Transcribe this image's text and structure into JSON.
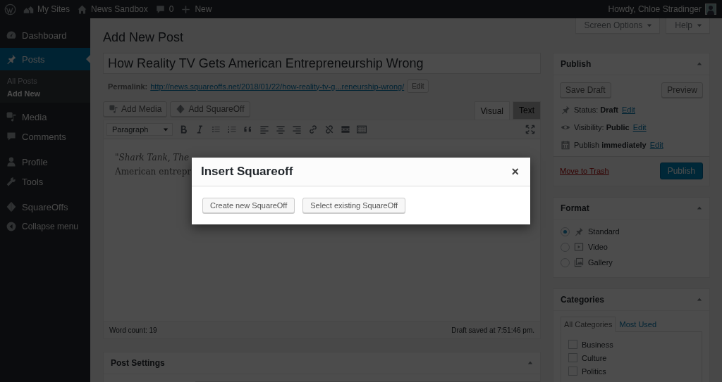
{
  "admin_bar": {
    "items": [
      {
        "kind": "logo"
      },
      {
        "kind": "sites",
        "label": "My Sites"
      },
      {
        "kind": "home",
        "label": "News Sandbox"
      },
      {
        "kind": "comments",
        "label": "0"
      },
      {
        "kind": "new",
        "label": "New"
      }
    ],
    "greeting": "Howdy, Chloe Stradinger"
  },
  "sidebar": {
    "items": [
      {
        "kind": "item",
        "label": "Dashboard",
        "selected": false
      },
      {
        "kind": "item",
        "label": "Posts",
        "selected": true,
        "children": [
          {
            "label": "All Posts",
            "selected": false
          },
          {
            "label": "Add New",
            "selected": true
          }
        ]
      },
      {
        "kind": "item",
        "label": "Media",
        "selected": false
      },
      {
        "kind": "item",
        "label": "Comments",
        "selected": false
      },
      {
        "kind": "separator"
      },
      {
        "kind": "item",
        "label": "Profile",
        "selected": false
      },
      {
        "kind": "item",
        "label": "Tools",
        "selected": false
      },
      {
        "kind": "separator"
      },
      {
        "kind": "item",
        "label": "SquareOffs",
        "selected": false
      },
      {
        "kind": "collapse",
        "label": "Collapse menu"
      }
    ]
  },
  "screen_meta": [
    "Screen Options",
    "Help"
  ],
  "page_title": "Add New Post",
  "post_title": "How Reality TV Gets American Entrepreneurship Wrong",
  "permalink": {
    "label": "Permalink:",
    "url": "http://news.squareoffs.net/2018/01/22/how-reality-tv-g...reneurship-wrong/",
    "edit": "Edit"
  },
  "media_buttons": [
    "Add Media",
    "Add SquareOff"
  ],
  "editor_tabs": [
    {
      "label": "Visual",
      "selected": true
    },
    {
      "label": "Text",
      "selected": false
    }
  ],
  "format_select": "Paragraph",
  "content_lines": [
    "\"*Shark Tank, The*",
    "American entrepr"
  ],
  "word_count": "Word count: 19",
  "draft_saved": "Draft saved at 7:51:46 pm.",
  "post_settings": {
    "title": "Post Settings"
  },
  "publish": {
    "title": "Publish",
    "save_draft": "Save Draft",
    "preview": "Preview",
    "rows": [
      {
        "text": "Status: **Draft**",
        "link": "Edit"
      },
      {
        "text": "Visibility: **Public**",
        "link": "Edit"
      },
      {
        "text": "Publish **immediately**",
        "link": "Edit"
      }
    ],
    "trash": "Move to Trash",
    "publish_button": "Publish"
  },
  "format": {
    "title": "Format",
    "options": [
      {
        "label": "Standard",
        "selected": true
      },
      {
        "label": "Video",
        "selected": false
      },
      {
        "label": "Gallery",
        "selected": false
      }
    ]
  },
  "categories": {
    "title": "Categories",
    "tabs": [
      {
        "label": "All Categories",
        "selected": true
      },
      {
        "label": "Most Used",
        "selected": false
      }
    ],
    "items": [
      {
        "label": "Business",
        "checked": false
      },
      {
        "label": "Culture",
        "checked": false
      },
      {
        "label": "Politics",
        "checked": false
      }
    ]
  },
  "modal": {
    "title": "Insert Squareoff",
    "close": "×",
    "buttons": [
      "Create new SquareOff",
      "Select existing SquareOff"
    ]
  }
}
